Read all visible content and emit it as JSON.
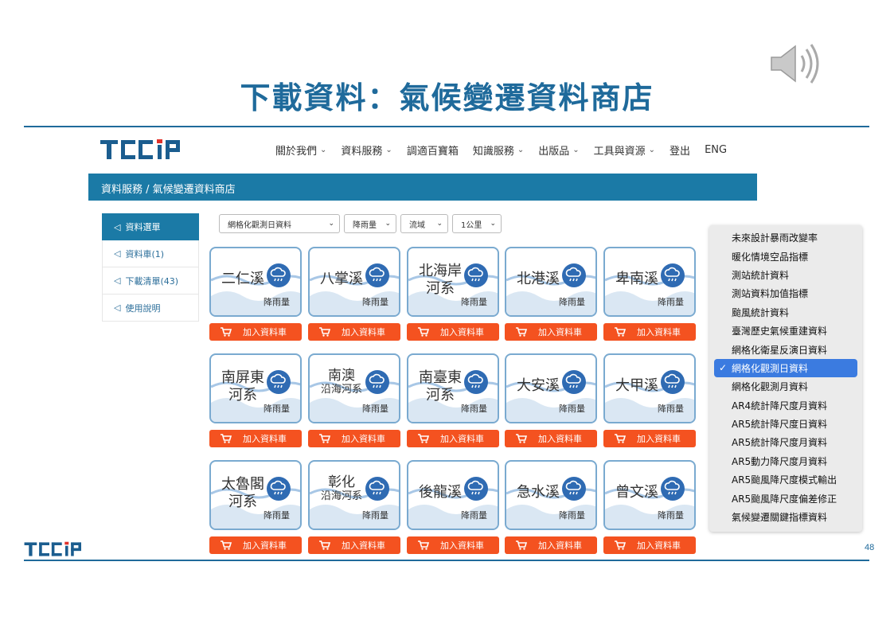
{
  "slide": {
    "title": "下載資料：氣候變遷資料商店",
    "page_number": "48",
    "footer_logo_text": "TCCIP"
  },
  "site": {
    "logo_text": "TCCIP",
    "nav": [
      {
        "label": "關於我們",
        "dropdown": true
      },
      {
        "label": "資料服務",
        "dropdown": true
      },
      {
        "label": "調適百寶箱",
        "dropdown": false
      },
      {
        "label": "知識服務",
        "dropdown": true
      },
      {
        "label": "出版品",
        "dropdown": true
      },
      {
        "label": "工具與資源",
        "dropdown": true
      },
      {
        "label": "登出",
        "dropdown": false
      },
      {
        "label": "ENG",
        "dropdown": false
      }
    ],
    "breadcrumb": "資料服務 / 氣候變遷資料商店"
  },
  "sidebar": {
    "items": [
      {
        "label": "資料選單",
        "active": true
      },
      {
        "label": "資料車(1)",
        "active": false
      },
      {
        "label": "下載清單(43)",
        "active": false
      },
      {
        "label": "使用說明",
        "active": false
      }
    ]
  },
  "filters": [
    {
      "value": "網格化觀測日資料"
    },
    {
      "value": "降雨量"
    },
    {
      "value": "流域"
    },
    {
      "value": "1公里"
    }
  ],
  "cards": [
    {
      "name": "二仁溪",
      "type": "降雨量"
    },
    {
      "name": "八掌溪",
      "type": "降雨量"
    },
    {
      "name": "北海岸河系",
      "type": "降雨量"
    },
    {
      "name": "北港溪",
      "type": "降雨量"
    },
    {
      "name": "卑南溪",
      "type": "降雨量"
    },
    {
      "name": "南屏東河系",
      "type": "降雨量"
    },
    {
      "name": "南澳沿海河系",
      "type": "降雨量"
    },
    {
      "name": "南臺東河系",
      "type": "降雨量"
    },
    {
      "name": "大安溪",
      "type": "降雨量"
    },
    {
      "name": "大甲溪",
      "type": "降雨量"
    },
    {
      "name": "太魯閣河系",
      "type": "降雨量"
    },
    {
      "name": "彰化沿海河系",
      "type": "降雨量"
    },
    {
      "name": "後龍溪",
      "type": "降雨量"
    },
    {
      "name": "急水溪",
      "type": "降雨量"
    },
    {
      "name": "曾文溪",
      "type": "降雨量"
    }
  ],
  "card_lines": [
    [
      "二仁溪"
    ],
    [
      "八掌溪"
    ],
    [
      "北海岸",
      "河系"
    ],
    [
      "北港溪"
    ],
    [
      "卑南溪"
    ],
    [
      "南屏東",
      "河系"
    ],
    [
      "南澳",
      "沿海河系"
    ],
    [
      "南臺東",
      "河系"
    ],
    [
      "大安溪"
    ],
    [
      "大甲溪"
    ],
    [
      "太魯閣",
      "河系"
    ],
    [
      "彰化",
      "沿海河系"
    ],
    [
      "後龍溪"
    ],
    [
      "急水溪"
    ],
    [
      "曾文溪"
    ]
  ],
  "cart_button_label": "加入資料車",
  "dropdown": {
    "options": [
      "未來設計暴雨改變率",
      "暖化情境空品指標",
      "測站統計資料",
      "測站資料加值指標",
      "颱風統計資料",
      "臺灣歷史氣候重建資料",
      "網格化衛星反演日資料",
      "網格化觀測日資料",
      "網格化觀測月資料",
      "AR4統計降尺度月資料",
      "AR5統計降尺度日資料",
      "AR5統計降尺度月資料",
      "AR5動力降尺度月資料",
      "AR5颱風降尺度模式輸出",
      "AR5颱風降尺度偏差修正",
      "氣候變遷關鍵指標資料"
    ],
    "selected_index": 7
  },
  "colors": {
    "title": "#1f6a9b",
    "header_bar": "#1b7aa6",
    "cart_button": "#f45220",
    "card_border": "#7aaad0",
    "rain_icon": "#2f6bb3",
    "dropdown_selected": "#3b7be0"
  },
  "icons": {
    "speaker": "speaker-icon",
    "rain": "rain-cloud-icon",
    "cart": "cart-icon",
    "sidebar": "paper-plane-icon",
    "check": "check-icon"
  }
}
